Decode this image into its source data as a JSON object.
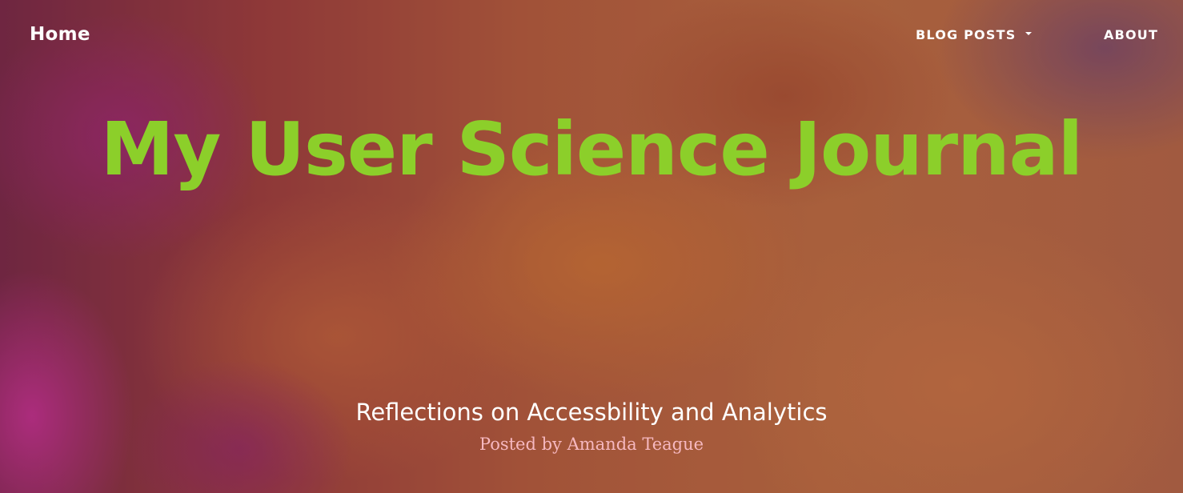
{
  "nav": {
    "brand": "Home",
    "items": [
      {
        "label": "BLOG POSTS",
        "has_dropdown": true
      },
      {
        "label": "ABOUT",
        "has_dropdown": false
      }
    ]
  },
  "hero": {
    "title": "My User Science Journal",
    "subtitle": "Reflections on Accessbility and Analytics",
    "posted_by": "Posted by Amanda Teague"
  },
  "colors": {
    "title": "#8ccf2a",
    "posted_by": "#f6b8c0",
    "nav_text": "#ffffff"
  },
  "icons": [
    "caret-down-icon"
  ]
}
